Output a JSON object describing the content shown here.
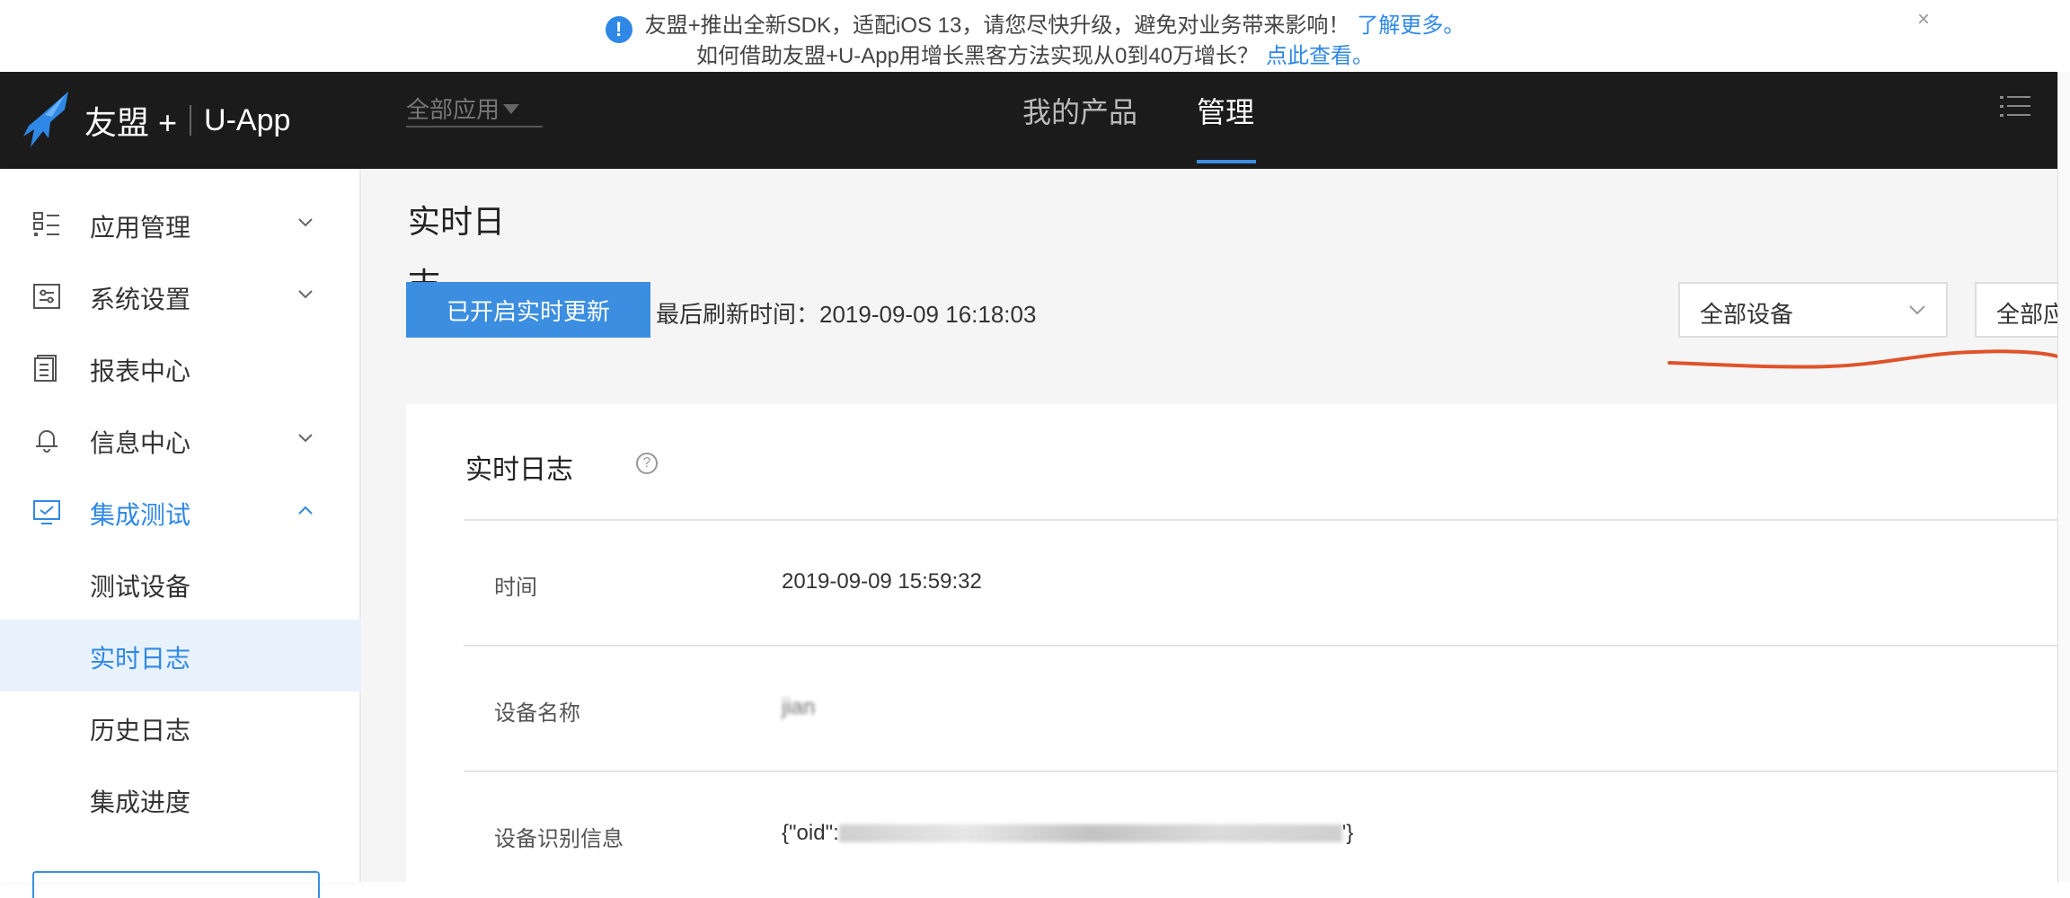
{
  "notice": {
    "line1": "友盟+推出全新SDK，适配iOS 13，请您尽快升级，避免对业务带来影响！",
    "line1_link": "了解更多。",
    "line2": "如何借助友盟+U-App用增长黑客方法实现从0到40万增长？",
    "line2_link": "点此查看。",
    "close": "×"
  },
  "topbar": {
    "brand": "友盟 +",
    "product": "U-App",
    "app_select": "全部应用",
    "nav": [
      {
        "label": "我的产品"
      },
      {
        "label": "管理"
      }
    ]
  },
  "sidebar": {
    "items": [
      {
        "label": "应用管理",
        "icon": "grid-list-icon"
      },
      {
        "label": "系统设置",
        "icon": "settings-sliders-icon"
      },
      {
        "label": "报表中心",
        "icon": "report-doc-icon"
      },
      {
        "label": "信息中心",
        "icon": "bell-icon"
      },
      {
        "label": "集成测试",
        "icon": "monitor-check-icon"
      }
    ],
    "sub_items": [
      {
        "label": "测试设备"
      },
      {
        "label": "实时日志"
      },
      {
        "label": "历史日志"
      },
      {
        "label": "集成进度"
      }
    ]
  },
  "content": {
    "page_title": "实时日志",
    "live_button": "已开启实时更新",
    "refresh_label": "最后刷新时间：",
    "refresh_time": "2019-09-09 16:18:03",
    "device_filter": "全部设备",
    "app_filter": "全部应",
    "card": {
      "title": "实时日志",
      "rows": [
        {
          "key": "时间",
          "value": "2019-09-09 15:59:32"
        },
        {
          "key": "设备名称",
          "value": "jian"
        },
        {
          "key": "设备识别信息",
          "value_prefix": "{\"oid\":",
          "value_suffix": "'}"
        }
      ]
    }
  },
  "colors": {
    "accent": "#3b8ee0",
    "topbar_bg": "#1b1b1b",
    "annotation": "#e0522a",
    "selected_bg": "#e8f2fc"
  }
}
